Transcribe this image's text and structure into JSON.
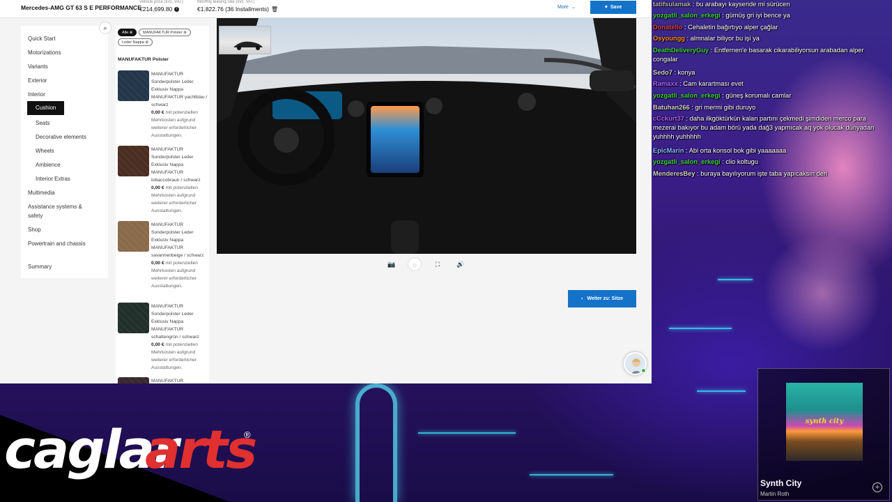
{
  "header": {
    "model_name": "Mercedes-AMG GT 63 S E PERFORMANCE",
    "vehicle_price_label": "Vehicle price (incl. VAT)",
    "vehicle_price": "€214,699.80",
    "leasing_label": "Monthly leasing rate (incl. VAT)",
    "leasing_value": "€1,822.76 (36 Installments)",
    "more_label": "More",
    "save_label": "Save"
  },
  "sidebar": {
    "items": [
      {
        "label": "Quick Start"
      },
      {
        "label": "Motorizations"
      },
      {
        "label": "Variants"
      },
      {
        "label": "Exterior"
      },
      {
        "label": "Interior"
      },
      {
        "label": "Cushion"
      },
      {
        "label": "Seats"
      },
      {
        "label": "Decorative elements"
      },
      {
        "label": "Wheels"
      },
      {
        "label": "Ambience"
      },
      {
        "label": "Interior Extras"
      },
      {
        "label": "Multimedia"
      },
      {
        "label": "Assistance systems & safety"
      },
      {
        "label": "Shop"
      },
      {
        "label": "Powertrain and chassis"
      },
      {
        "label": "Summary"
      }
    ],
    "active": "Cushion"
  },
  "filters": {
    "chips": [
      "Alle",
      "MANUFAKTUR Polster",
      "Leder Nappa"
    ]
  },
  "options": {
    "heading": "MANUFAKTUR Polster",
    "items": [
      {
        "title": "MANUFAKTUR Sonderpolster Leder Exklusiv Nappa MANUFAKTUR yachtblau / schwarz",
        "price": "0,00 €",
        "note": "mit potenziellen Mehrkosten aufgrund weiterer erforderlicher Ausstattungen.",
        "color": "#23364a"
      },
      {
        "title": "MANUFAKTUR Sonderpolster Leder Exklusiv Nappa MANUFAKTUR tobaccobraun / schwarz",
        "price": "0,00 €",
        "note": "mit potenziellen Mehrkosten aufgrund weiterer erforderlicher Ausstattungen.",
        "color": "#4a2e22"
      },
      {
        "title": "MANUFAKTUR Sonderpolster Leder Exklusiv Nappa MANUFAKTUR savannenbeige / schwarz",
        "price": "0,00 €",
        "note": "mit potenziellen Mehrkosten aufgrund weiterer erforderlicher Ausstattungen.",
        "color": "#8a6a4a"
      },
      {
        "title": "MANUFAKTUR Sonderpolster Leder Exklusiv Nappa MANUFAKTUR schattengrün / schwarz",
        "price": "0,00 €",
        "note": "mit potenziellen Mehrkosten aufgrund weiterer erforderlicher Ausstattungen.",
        "color": "#22302b"
      },
      {
        "title": "MANUFAKTUR",
        "price": "",
        "note": "",
        "color": "#3a2a2e"
      }
    ]
  },
  "viewer": {
    "controls": [
      "camera-icon",
      "light-icon",
      "fullscreen-icon",
      "sound-icon"
    ],
    "next_label": "Weiter zu: Sitze"
  },
  "chat": {
    "messages": [
      {
        "user": "tatifsulamak",
        "text": "bu arabayı kayseride mi sürücen",
        "color": "#b0b0b0"
      },
      {
        "user": "yozgatli_salon_erkegi",
        "text": "gümüş gri iyi bence ya",
        "color": "#3ad13a"
      },
      {
        "user": "Donatello",
        "text": "Cehaletin bağırtıyo alper çağlar",
        "color": "#e04040"
      },
      {
        "user": "Osyoungg",
        "text": "almnalar biliyor bu işi ya",
        "color": "#ff8c1a"
      },
      {
        "user": "DeathDeliveryGuy",
        "text": "Entfernen'e basarak cikarabiliyorsun arabadan alper congalar",
        "color": "#3ad13a"
      },
      {
        "user": "Sedo7",
        "text": "konya",
        "color": "#d0d0d0"
      },
      {
        "user": "Ramaxx",
        "text": "Cam karartması evet",
        "color": "#b060ff"
      },
      {
        "user": "yozgatli_salon_erkegi",
        "text": "güneş korumalı camlar",
        "color": "#3ad13a"
      },
      {
        "user": "Batuhan266",
        "text": "gri mermi gibi duruyo",
        "color": "#d0d0d0"
      },
      {
        "user": "cCckurt37",
        "text": "daha ilkgöktürkün kalan partını çekmedi şimdiden merco para mezerai bakıyor bu adam börü yada dağ3 yapmıcak aq yok olucak dünyadan yuhhhh yuhhhhh",
        "color": "#b060ff"
      },
      {
        "user": "EpicMarin",
        "text": "Abi orta konsol bok gibi yaaaaaaa",
        "color": "#8ab8ff"
      },
      {
        "user": "yozgatli_salon_erkegi",
        "text": "clio koltugu",
        "color": "#3ad13a"
      },
      {
        "user": "MenderesBey",
        "text": "buraya bayılıyorum işte taba yapıcaksın deri",
        "color": "#d0d0d0"
      }
    ]
  },
  "overlay": {
    "logo_part1": "caglar",
    "logo_part2": "arts",
    "logo_reg": "®",
    "album_art_text": "synth city",
    "track_title": "Synth City",
    "track_artist": "Martin Roth"
  }
}
